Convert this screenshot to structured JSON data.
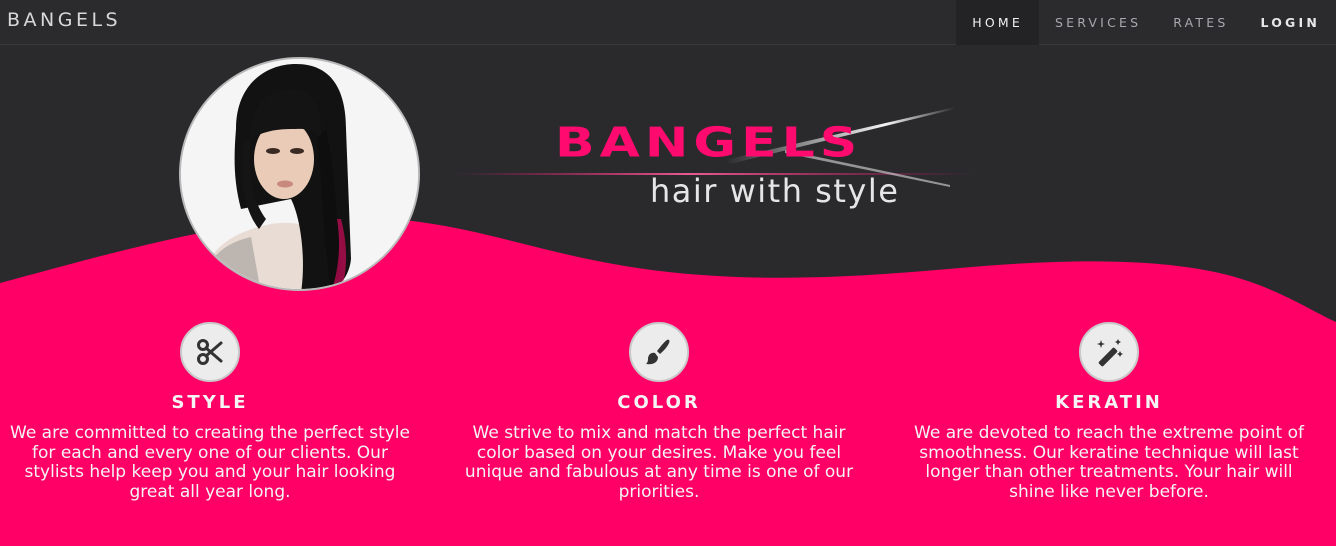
{
  "navbar": {
    "brand": "BANGELS",
    "links": [
      {
        "label": "HOME"
      },
      {
        "label": "SERVICES"
      },
      {
        "label": "RATES"
      },
      {
        "label": "LOGIN"
      }
    ]
  },
  "hero": {
    "logo_word": "BANGELS",
    "logo_tagline": "hair with style"
  },
  "features": [
    {
      "icon": "scissors-icon",
      "title": "STYLE",
      "text": "We are committed to creating the perfect style for each and every one of our clients.  Our stylists help keep you and your hair looking great all year long."
    },
    {
      "icon": "paint-brush-icon",
      "title": "COLOR",
      "text": "We strive to mix and match the perfect hair color based on your desires.   Make you feel unique and fabulous at any time is one of our priorities."
    },
    {
      "icon": "magic-wand-icon",
      "title": "KERATIN",
      "text": "We are devoted to reach the extreme point of smoothness. Our keratine technique will last longer than other treatments.   Your hair will shine like never before."
    }
  ],
  "colors": {
    "accent": "#ff0066",
    "dark": "#2b2b2e"
  }
}
